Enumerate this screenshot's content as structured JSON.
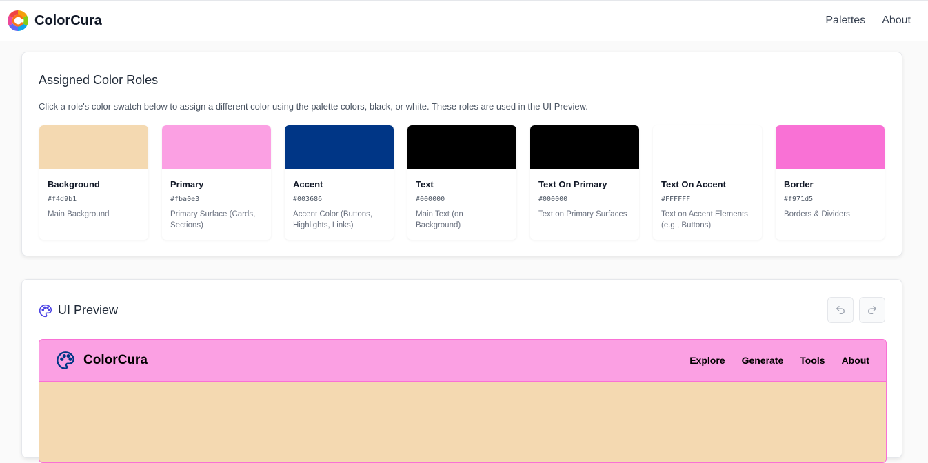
{
  "app": {
    "name": "ColorCura",
    "nav": [
      "Palettes",
      "About"
    ]
  },
  "roles_section": {
    "title": "Assigned Color Roles",
    "description": "Click a role's color swatch below to assign a different color using the palette colors, black, or white. These roles are used in the UI Preview.",
    "roles": [
      {
        "name": "Background",
        "hex": "#f4d9b1",
        "desc": "Main Background",
        "color": "#f4d9b1"
      },
      {
        "name": "Primary",
        "hex": "#fba0e3",
        "desc": "Primary Surface (Cards, Sections)",
        "color": "#fba0e3"
      },
      {
        "name": "Accent",
        "hex": "#003686",
        "desc": "Accent Color (Buttons, Highlights, Links)",
        "color": "#003686"
      },
      {
        "name": "Text",
        "hex": "#000000",
        "desc": "Main Text (on Background)",
        "color": "#000000"
      },
      {
        "name": "Text On Primary",
        "hex": "#000000",
        "desc": "Text on Primary Surfaces",
        "color": "#000000"
      },
      {
        "name": "Text On Accent",
        "hex": "#FFFFFF",
        "desc": "Text on Accent Elements (e.g., Buttons)",
        "color": "#FFFFFF"
      },
      {
        "name": "Border",
        "hex": "#f971d5",
        "desc": "Borders & Dividers",
        "color": "#f971d5"
      }
    ]
  },
  "preview_section": {
    "title": "UI Preview",
    "icons": {
      "title": "palette-icon",
      "undo": "undo-icon",
      "redo": "redo-icon"
    },
    "mock": {
      "brand": "ColorCura",
      "nav": [
        "Explore",
        "Generate",
        "Tools",
        "About"
      ]
    }
  },
  "colors": {
    "accent_icon": "#4f46e5",
    "mock_header": "#fba0e3",
    "mock_background": "#f4d9b1",
    "mock_border": "#f971d5"
  }
}
